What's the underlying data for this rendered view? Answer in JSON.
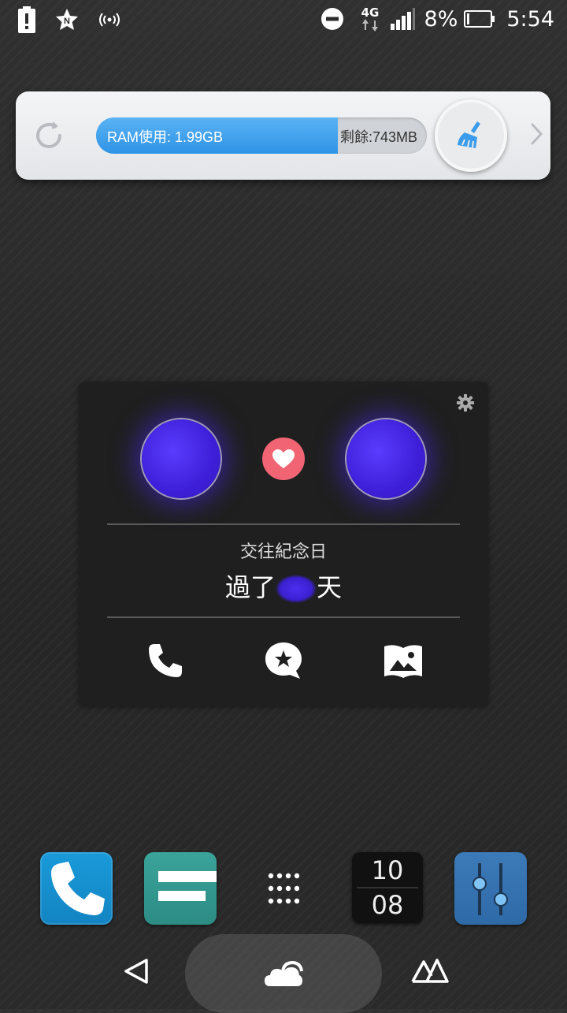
{
  "status_bar": {
    "icons_left": [
      "battery-alert-icon",
      "star-n-icon",
      "wireless-signal-icon"
    ],
    "icons_right": [
      "do-not-disturb-icon",
      "4g-data-icon",
      "cell-signal-icon"
    ],
    "network_label": "4G",
    "battery_percent": "8%",
    "battery_level": 0.08,
    "time": "5:54"
  },
  "ram_widget": {
    "used_label": "RAM使用: 1.99GB",
    "free_label": "剩餘:743MB",
    "used_fraction": 0.73,
    "bar_color": "#3a9ceb",
    "icons": [
      "refresh-icon",
      "broom-icon",
      "chevron-right-icon"
    ]
  },
  "anniversary": {
    "title": "交往紀念日",
    "days_prefix": "過了",
    "days_value": "",
    "days_suffix": "天",
    "heart_color": "#f16473",
    "icons": [
      "gear-icon",
      "heart-icon",
      "phone-icon",
      "chat-star-icon",
      "photo-album-icon"
    ]
  },
  "dock": {
    "apps": [
      "phone-app-icon",
      "messages-app-icon",
      "app-drawer-icon",
      "clock-widget",
      "settings-app-icon"
    ],
    "clock_hour": "10",
    "clock_minute": "08"
  },
  "nav_bar": {
    "icons": [
      "back-icon",
      "cloud-home-icon",
      "recent-apps-icon"
    ]
  }
}
